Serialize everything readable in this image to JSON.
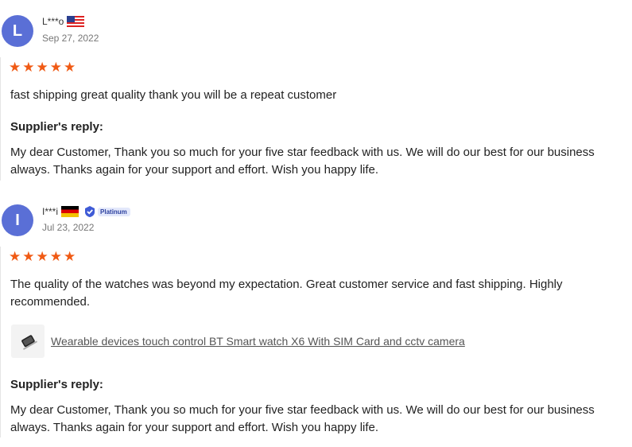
{
  "reviews": [
    {
      "avatar_letter": "L",
      "name": "L***o",
      "flag": "us-flag-icon",
      "date": "Sep 27, 2022",
      "rating": 5,
      "text": "fast shipping great quality thank you will be a repeat customer",
      "reply_heading": "Supplier's reply:",
      "reply_text": "My dear Customer, Thank you so much for your five star feedback with us. We will do our best for our business always. Thanks again for your support and effort. Wish you happy life."
    },
    {
      "avatar_letter": "I",
      "name": "I***i",
      "flag": "germany-flag-icon",
      "badge": "Platinum",
      "date": "Jul 23, 2022",
      "rating": 5,
      "text": "The quality of the watches was beyond my expectation. Great customer service and fast shipping. Highly recommended.",
      "product_link": "Wearable devices touch control BT Smart watch X6 With SIM Card and cctv camera",
      "reply_heading": "Supplier's reply:",
      "reply_text": "My dear Customer, Thank you so much for your five star feedback with us. We will do our best for our business always. Thanks again for your support and effort. Wish you happy life."
    }
  ],
  "colors": {
    "star": "#f05a14",
    "avatar": "#5a6fd6",
    "badge_text": "#2b3f9e"
  }
}
